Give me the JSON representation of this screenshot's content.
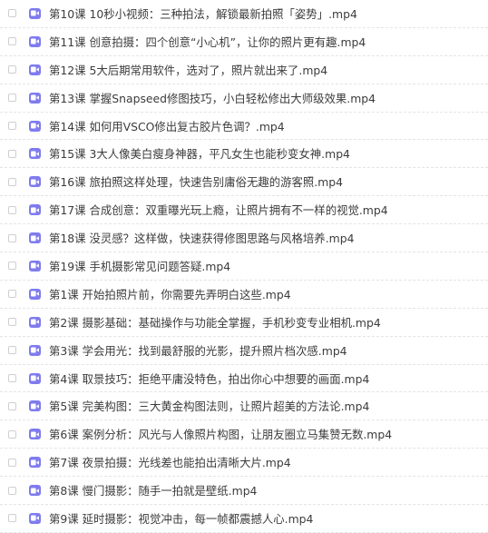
{
  "files": [
    {
      "name": "第10课 10秒小视频：三种拍法，解锁最新拍照「姿势」.mp4"
    },
    {
      "name": "第11课 创意拍摄：四个创意“小心机”，让你的照片更有趣.mp4"
    },
    {
      "name": "第12课 5大后期常用软件，选对了，照片就出来了.mp4"
    },
    {
      "name": "第13课 掌握Snapseed修图技巧，小白轻松修出大师级效果.mp4"
    },
    {
      "name": "第14课 如何用VSCO修出复古胶片色调？.mp4"
    },
    {
      "name": "第15课 3大人像美白瘦身神器，平凡女生也能秒变女神.mp4"
    },
    {
      "name": "第16课 旅拍照这样处理，快速告别庸俗无趣的游客照.mp4"
    },
    {
      "name": "第17课 合成创意：双重曝光玩上瘾，让照片拥有不一样的视觉.mp4"
    },
    {
      "name": "第18课 没灵感？这样做，快速获得修图思路与风格培养.mp4"
    },
    {
      "name": "第19课 手机摄影常见问题答疑.mp4"
    },
    {
      "name": "第1课 开始拍照片前，你需要先弄明白这些.mp4"
    },
    {
      "name": "第2课 摄影基础：基础操作与功能全掌握，手机秒变专业相机.mp4"
    },
    {
      "name": "第3课 学会用光：找到最舒服的光影，提升照片档次感.mp4"
    },
    {
      "name": "第4课 取景技巧：拒绝平庸没特色，拍出你心中想要的画面.mp4"
    },
    {
      "name": "第5课 完美构图：三大黄金构图法则，让照片超美的方法论.mp4"
    },
    {
      "name": "第6课 案例分析：风光与人像照片构图，让朋友圈立马集赞无数.mp4"
    },
    {
      "name": "第7课 夜景拍摄：光线差也能拍出清晰大片.mp4"
    },
    {
      "name": "第8课 慢门摄影：随手一拍就是壁纸.mp4"
    },
    {
      "name": "第9课 延时摄影：视觉冲击，每一帧都震撼人心.mp4"
    }
  ],
  "colors": {
    "icon": "#7e7bf0",
    "text": "#3c3c3c",
    "divider": "#e4e4e4"
  },
  "icons": {
    "file": "video-camera-icon"
  }
}
